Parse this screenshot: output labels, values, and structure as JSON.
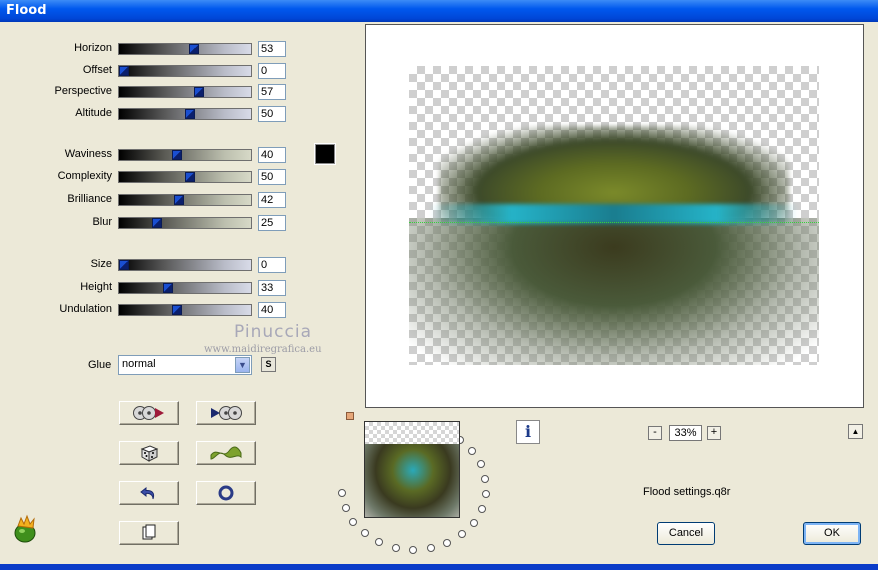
{
  "window": {
    "title": "Flood"
  },
  "params": {
    "horizon": {
      "label": "Horizon",
      "value": "53",
      "pos": 0.53
    },
    "offset": {
      "label": "Offset",
      "value": "0",
      "pos": 0.0
    },
    "perspective": {
      "label": "Perspective",
      "value": "57",
      "pos": 0.57
    },
    "altitude": {
      "label": "Altitude",
      "value": "50",
      "pos": 0.5
    },
    "waviness": {
      "label": "Waviness",
      "value": "40",
      "pos": 0.4
    },
    "complexity": {
      "label": "Complexity",
      "value": "50",
      "pos": 0.5
    },
    "brilliance": {
      "label": "Brilliance",
      "value": "42",
      "pos": 0.42
    },
    "blur": {
      "label": "Blur",
      "value": "25",
      "pos": 0.25
    },
    "size": {
      "label": "Size",
      "value": "0",
      "pos": 0.0
    },
    "height": {
      "label": "Height",
      "value": "33",
      "pos": 0.33
    },
    "undulation": {
      "label": "Undulation",
      "value": "40",
      "pos": 0.4
    }
  },
  "color_swatch": "#000000",
  "watermark": {
    "line1": "Pinuccia",
    "line2": "www.maidiregrafica.eu"
  },
  "glue": {
    "label": "Glue",
    "value": "normal",
    "s_label": "S"
  },
  "icons": {
    "random": "random-dice-icon",
    "wave": "wave-icon",
    "reset": "undo-icon",
    "stop": "circle-icon",
    "copy": "copy-icon",
    "reel_back": "film-reel-back-icon",
    "reel_forward": "film-reel-forward-icon",
    "info": "info-icon",
    "logo": "filter-logo-icon"
  },
  "preview": {
    "info_label": "i",
    "zoom_minus": "-",
    "zoom_value": "33%",
    "zoom_plus": "+",
    "up_label": "▲"
  },
  "settings_name": "Flood settings.q8r",
  "buttons": {
    "cancel": "Cancel",
    "ok": "OK"
  },
  "colors": {
    "accent": "#0058ee",
    "water": "#25b3c8",
    "horizon_line": "#36d23a"
  }
}
